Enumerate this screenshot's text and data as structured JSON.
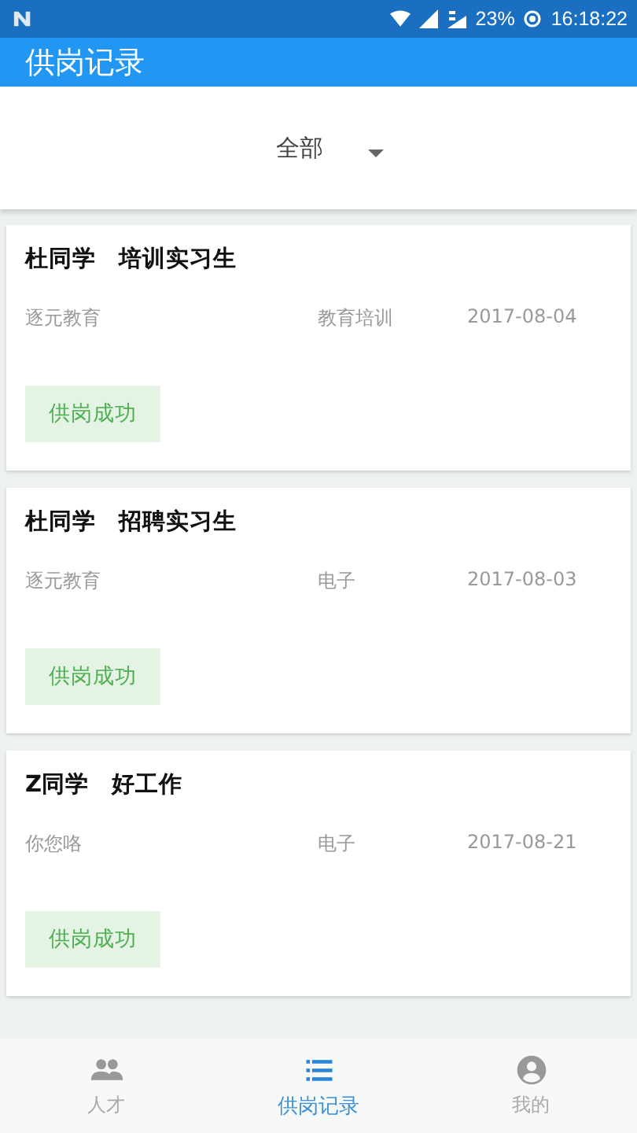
{
  "status_bar": {
    "battery": "23%",
    "time": "16:18:22"
  },
  "app_bar": {
    "title": "供岗记录"
  },
  "filter": {
    "value": "全部"
  },
  "records": [
    {
      "name": "杜同学",
      "position": "培训实习生",
      "company": "逐元教育",
      "industry": "教育培训",
      "date": "2017-08-04",
      "status": "供岗成功"
    },
    {
      "name": "杜同学",
      "position": "招聘实习生",
      "company": "逐元教育",
      "industry": "电子",
      "date": "2017-08-03",
      "status": "供岗成功"
    },
    {
      "name": "Z同学",
      "position": "好工作",
      "company": "你您咯",
      "industry": "电子",
      "date": "2017-08-21",
      "status": "供岗成功"
    }
  ],
  "bottom_nav": [
    {
      "kind": "people",
      "label": "人才",
      "selected": false
    },
    {
      "kind": "list",
      "label": "供岗记录",
      "selected": true
    },
    {
      "kind": "account",
      "label": "我的",
      "selected": false
    }
  ]
}
